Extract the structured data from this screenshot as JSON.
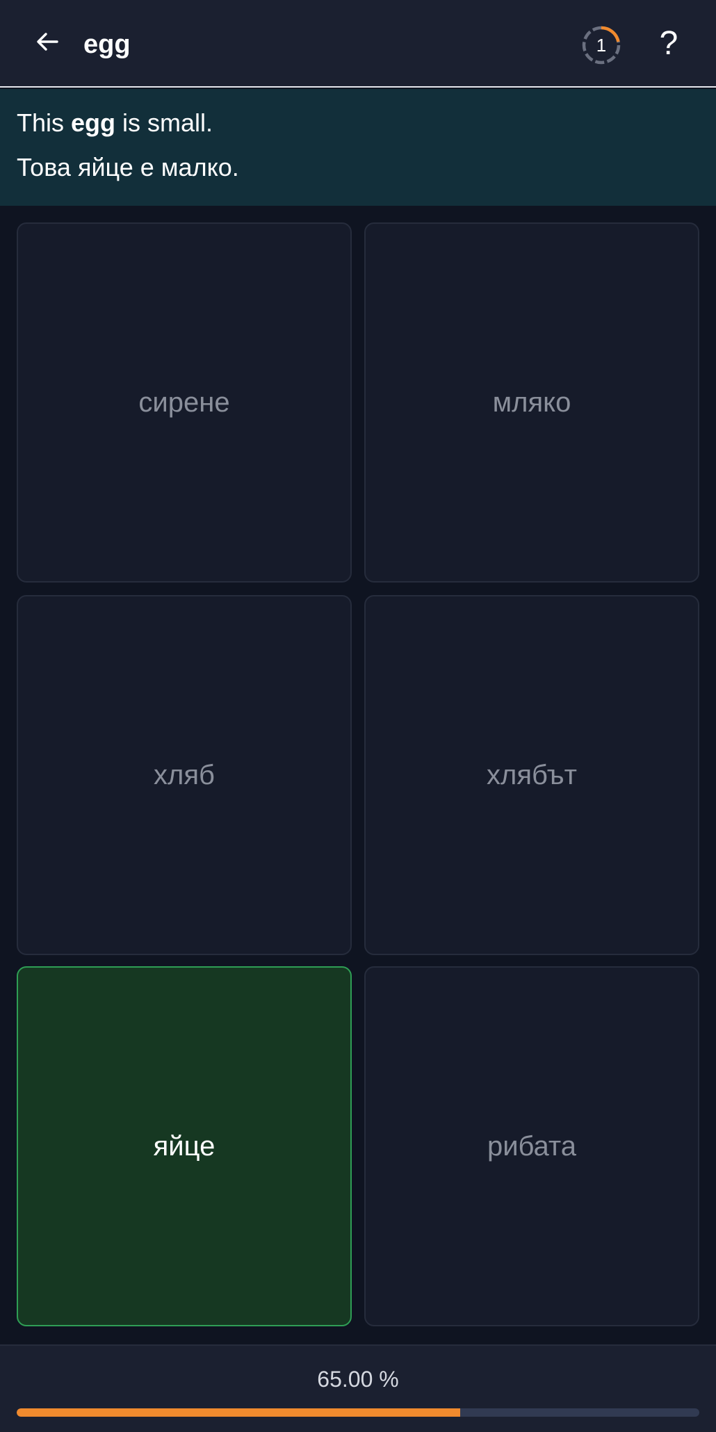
{
  "header": {
    "title": "egg",
    "timer_count": "1",
    "help_label": "?"
  },
  "sentence": {
    "english_before": "This ",
    "english_keyword": "egg",
    "english_after": " is small.",
    "translation": "Това яйце е малко."
  },
  "options": [
    {
      "label": "сирене",
      "state": "default"
    },
    {
      "label": "мляко",
      "state": "default"
    },
    {
      "label": "хляб",
      "state": "default"
    },
    {
      "label": "хлябът",
      "state": "default"
    },
    {
      "label": "яйце",
      "state": "correct"
    },
    {
      "label": "рибата",
      "state": "default"
    }
  ],
  "progress": {
    "label": "65.00 %",
    "value": 0.65
  },
  "icons": {
    "back": "arrow-left-icon",
    "timer": "timer-ring-icon",
    "help": "question-mark-icon"
  },
  "colors": {
    "header_bg": "#1b2030",
    "sentence_bg": "#122f3a",
    "page_bg": "#0f1421",
    "option_bg": "#161b2a",
    "correct_bg": "#163822",
    "correct_border": "#2f9e55",
    "accent": "#f08a2e"
  }
}
